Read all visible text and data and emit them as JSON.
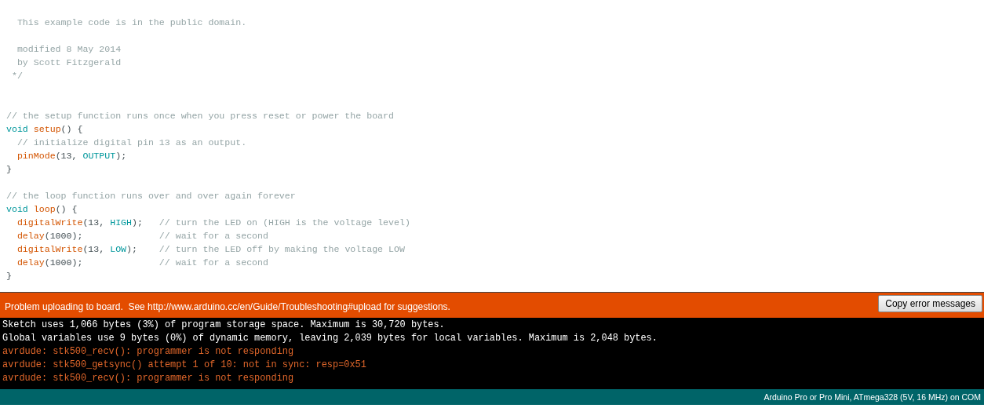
{
  "editor": {
    "lines": [
      {
        "kind": "blank"
      },
      {
        "kind": "code",
        "segments": [
          {
            "kind": "comment",
            "text": "  This example code is in the public domain."
          }
        ]
      },
      {
        "kind": "blank"
      },
      {
        "kind": "code",
        "segments": [
          {
            "kind": "comment",
            "text": "  modified 8 May 2014"
          }
        ]
      },
      {
        "kind": "code",
        "segments": [
          {
            "kind": "comment",
            "text": "  by Scott Fitzgerald"
          }
        ]
      },
      {
        "kind": "code",
        "segments": [
          {
            "kind": "comment",
            "text": " */"
          }
        ]
      },
      {
        "kind": "blank"
      },
      {
        "kind": "blank"
      },
      {
        "kind": "code",
        "segments": [
          {
            "kind": "comment",
            "text": "// the setup function runs once when you press reset or power the board"
          }
        ]
      },
      {
        "kind": "code",
        "segments": [
          {
            "kind": "keyword",
            "text": "void "
          },
          {
            "kind": "function",
            "text": "setup"
          },
          {
            "kind": "plain",
            "text": "() {"
          }
        ]
      },
      {
        "kind": "code",
        "segments": [
          {
            "kind": "comment",
            "text": "  // initialize digital pin 13 as an output."
          }
        ]
      },
      {
        "kind": "code",
        "segments": [
          {
            "kind": "function",
            "text": "  pinMode"
          },
          {
            "kind": "plain",
            "text": "(13, "
          },
          {
            "kind": "constant",
            "text": "OUTPUT"
          },
          {
            "kind": "plain",
            "text": ");"
          }
        ]
      },
      {
        "kind": "code",
        "segments": [
          {
            "kind": "plain",
            "text": "}"
          }
        ]
      },
      {
        "kind": "blank"
      },
      {
        "kind": "code",
        "segments": [
          {
            "kind": "comment",
            "text": "// the loop function runs over and over again forever"
          }
        ]
      },
      {
        "kind": "code",
        "segments": [
          {
            "kind": "keyword",
            "text": "void "
          },
          {
            "kind": "function",
            "text": "loop"
          },
          {
            "kind": "plain",
            "text": "() {"
          }
        ]
      },
      {
        "kind": "code",
        "segments": [
          {
            "kind": "function",
            "text": "  digitalWrite"
          },
          {
            "kind": "plain",
            "text": "(13, "
          },
          {
            "kind": "constant",
            "text": "HIGH"
          },
          {
            "kind": "plain",
            "text": ");   "
          },
          {
            "kind": "comment",
            "text": "// turn the LED on (HIGH is the voltage level)"
          }
        ]
      },
      {
        "kind": "code",
        "segments": [
          {
            "kind": "function",
            "text": "  delay"
          },
          {
            "kind": "plain",
            "text": "(1000);              "
          },
          {
            "kind": "comment",
            "text": "// wait for a second"
          }
        ]
      },
      {
        "kind": "code",
        "segments": [
          {
            "kind": "function",
            "text": "  digitalWrite"
          },
          {
            "kind": "plain",
            "text": "(13, "
          },
          {
            "kind": "constant",
            "text": "LOW"
          },
          {
            "kind": "plain",
            "text": ");    "
          },
          {
            "kind": "comment",
            "text": "// turn the LED off by making the voltage LOW"
          }
        ]
      },
      {
        "kind": "code",
        "segments": [
          {
            "kind": "function",
            "text": "  delay"
          },
          {
            "kind": "plain",
            "text": "(1000);              "
          },
          {
            "kind": "comment",
            "text": "// wait for a second"
          }
        ]
      },
      {
        "kind": "code",
        "segments": [
          {
            "kind": "plain",
            "text": "}"
          }
        ]
      }
    ]
  },
  "error_bar": {
    "message": "Problem uploading to board.  See http://www.arduino.cc/en/Guide/Troubleshooting#upload for suggestions.",
    "button": "Copy error messages"
  },
  "console": {
    "lines": [
      {
        "kind": "info",
        "text": "Sketch uses 1,066 bytes (3%) of program storage space. Maximum is 30,720 bytes."
      },
      {
        "kind": "info",
        "text": "Global variables use 9 bytes (0%) of dynamic memory, leaving 2,039 bytes for local variables. Maximum is 2,048 bytes."
      },
      {
        "kind": "error",
        "text": "avrdude: stk500_recv(): programmer is not responding"
      },
      {
        "kind": "error",
        "text": "avrdude: stk500_getsync() attempt 1 of 10: not in sync: resp=0x51"
      },
      {
        "kind": "error",
        "text": "avrdude: stk500_recv(): programmer is not responding"
      }
    ]
  },
  "status_bar": {
    "board": "Arduino Pro or Pro Mini, ATmega328 (5V, 16 MHz) on COM"
  }
}
